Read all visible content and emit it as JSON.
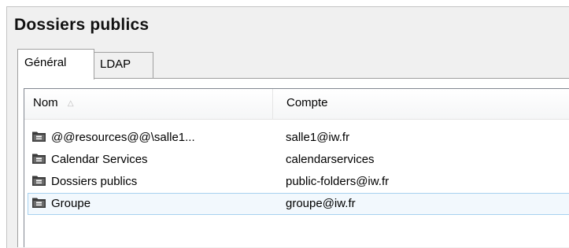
{
  "window": {
    "title": "Dossiers publics"
  },
  "tabs": [
    {
      "label": "Général",
      "active": true
    },
    {
      "label": "LDAP",
      "active": false
    }
  ],
  "list": {
    "columns": [
      {
        "label": "Nom",
        "sorted": "ascending"
      },
      {
        "label": "Compte"
      }
    ],
    "rows": [
      {
        "name": "@@resources@@\\salle1...",
        "account": "salle1@iw.fr",
        "icon": "public-folder-icon",
        "selected": false
      },
      {
        "name": "Calendar Services",
        "account": "calendarservices",
        "icon": "public-folder-icon",
        "selected": false
      },
      {
        "name": "Dossiers publics",
        "account": "public-folders@iw.fr",
        "icon": "public-folder-icon",
        "selected": false
      },
      {
        "name": "Groupe",
        "account": "groupe@iw.fr",
        "icon": "public-folder-icon",
        "selected": true
      }
    ]
  },
  "colors": {
    "panel_background": "#f0f0f0",
    "selection_background": "#f2f8fd",
    "selection_border": "#a7d1ef",
    "folder_icon": "#3a3a3a"
  }
}
